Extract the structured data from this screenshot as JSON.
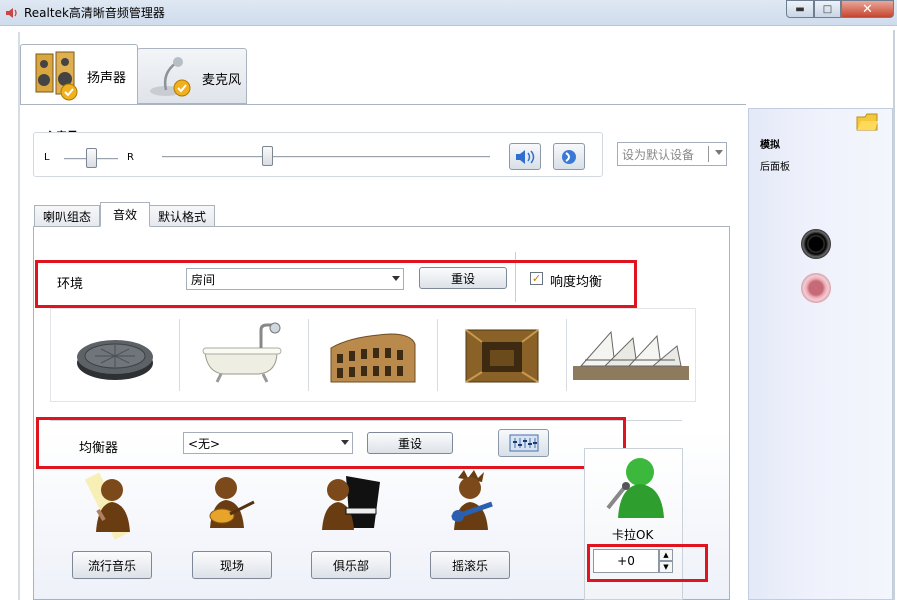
{
  "window": {
    "title": "Realtek高清晰音频管理器"
  },
  "device_tabs": [
    {
      "label": "扬声器"
    },
    {
      "label": "麦克风"
    }
  ],
  "volume": {
    "label": "主音量",
    "left": "L",
    "right": "R",
    "default_device_label": "设为默认设备",
    "master_level": 0.32,
    "balance": 0.5
  },
  "sub_tabs": [
    {
      "label": "喇叭组态"
    },
    {
      "label": "音效"
    },
    {
      "label": "默认格式"
    }
  ],
  "environment": {
    "label": "环境",
    "selected": "房间",
    "reset_label": "重设",
    "loudness_label": "响度均衡",
    "loudness_checked": true,
    "presets": [
      {
        "icon": "sewer-pipe-icon"
      },
      {
        "icon": "bathtub-icon"
      },
      {
        "icon": "colosseum-icon"
      },
      {
        "icon": "stone-corridor-icon"
      },
      {
        "icon": "opera-house-icon"
      }
    ]
  },
  "equalizer": {
    "label": "均衡器",
    "selected": "<无>",
    "reset_label": "重设",
    "presets": [
      {
        "label": "流行音乐",
        "icon": "pop-singer-icon"
      },
      {
        "label": "现场",
        "icon": "guitarist-icon"
      },
      {
        "label": "俱乐部",
        "icon": "pianist-icon"
      },
      {
        "label": "摇滚乐",
        "icon": "rocker-icon"
      }
    ]
  },
  "karaoke": {
    "label": "卡拉OK",
    "value": "+0"
  },
  "side_panel": {
    "title": "模拟",
    "subtitle": "后面板"
  },
  "colors": {
    "highlight_red": "#e0141e",
    "jack_black": "#111111",
    "jack_pink": "#e7a3ad"
  }
}
